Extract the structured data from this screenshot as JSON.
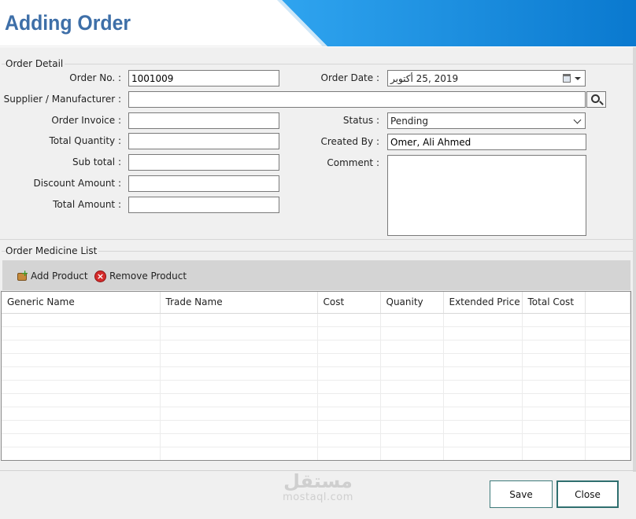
{
  "header": {
    "title": "Adding Order"
  },
  "order_detail": {
    "legend": "Order Detail",
    "order_no": {
      "label": "Order No. :",
      "value": "1001009"
    },
    "order_date": {
      "label": "Order Date :",
      "value": "2019 ,25 أكتوبر"
    },
    "supplier": {
      "label": "Supplier / Manufacturer :",
      "value": ""
    },
    "order_invoice": {
      "label": "Order Invoice :",
      "value": ""
    },
    "status": {
      "label": "Status :",
      "value": "Pending"
    },
    "total_quantity": {
      "label": "Total Quantity :",
      "value": ""
    },
    "created_by": {
      "label": "Created By :",
      "value": "Omer, Ali Ahmed"
    },
    "sub_total": {
      "label": "Sub total :",
      "value": ""
    },
    "comment": {
      "label": "Comment :",
      "value": ""
    },
    "discount_amount": {
      "label": "Discount Amount :",
      "value": ""
    },
    "total_amount": {
      "label": "Total Amount :",
      "value": ""
    }
  },
  "medicine_list": {
    "legend": "Order Medicine List",
    "add_label": "Add Product",
    "remove_label": "Remove Product",
    "columns": [
      "Generic Name",
      "Trade Name",
      "Cost",
      "Quanity",
      "Extended Price",
      "Total Cost"
    ]
  },
  "footer": {
    "save_label": "Save",
    "close_label": "Close",
    "watermark_ar": "مستقل",
    "watermark_lat": "mostaql.com"
  },
  "colors": {
    "header_blue": "#1b8fe0",
    "title_blue": "#3e6fa8",
    "accent_teal": "#2f6f6f"
  },
  "icons": {
    "search": "search-icon",
    "calendar": "calendar-icon",
    "add": "add-product-icon",
    "remove": "remove-icon"
  }
}
